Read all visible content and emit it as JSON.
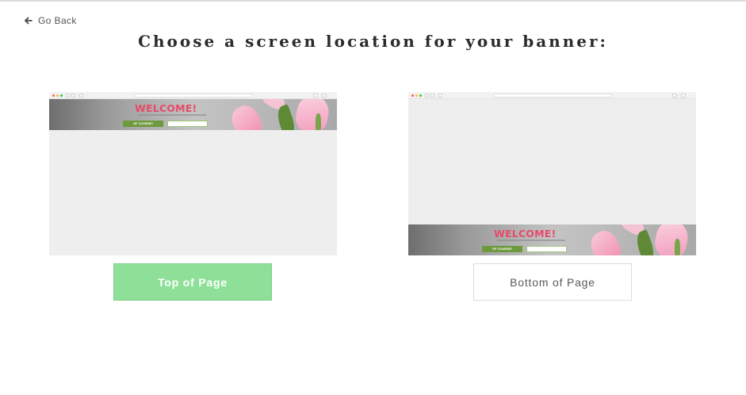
{
  "nav": {
    "go_back_label": "Go Back",
    "go_back_icon": "arrow-left-icon"
  },
  "page": {
    "title": "Choose a screen location for your banner:"
  },
  "options": [
    {
      "button_label": "Top of Page",
      "selected": true,
      "banner_position": "top",
      "preview": {
        "welcome": "WELCOME!",
        "primary_btn": "OF COURSE!"
      }
    },
    {
      "button_label": "Bottom of Page",
      "selected": false,
      "banner_position": "bottom",
      "preview": {
        "welcome": "WELCOME!",
        "primary_btn": "OF COURSE!"
      }
    }
  ],
  "colors": {
    "selected_button": "#8ee098",
    "welcome_text": "#e84a6a",
    "primary_preview_button": "#6c9a3c"
  }
}
